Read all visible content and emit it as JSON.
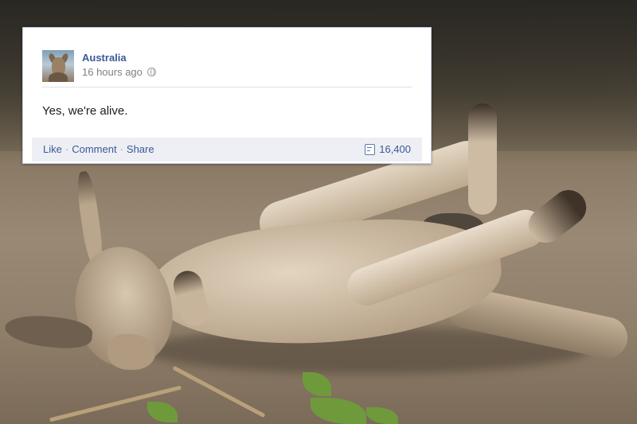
{
  "post": {
    "page_name": "Australia",
    "timestamp": "16 hours ago",
    "privacy_icon": "globe-icon",
    "text": "Yes, we're alive.",
    "actions": {
      "like": "Like",
      "comment": "Comment",
      "share": "Share"
    },
    "share_count": "16,400",
    "share_count_icon": "share-count-icon"
  },
  "colors": {
    "link": "#3b5998",
    "footer_bg": "#edeff4",
    "meta_text": "#808080"
  },
  "background": {
    "subject": "kangaroo-lying-on-back-photo"
  }
}
